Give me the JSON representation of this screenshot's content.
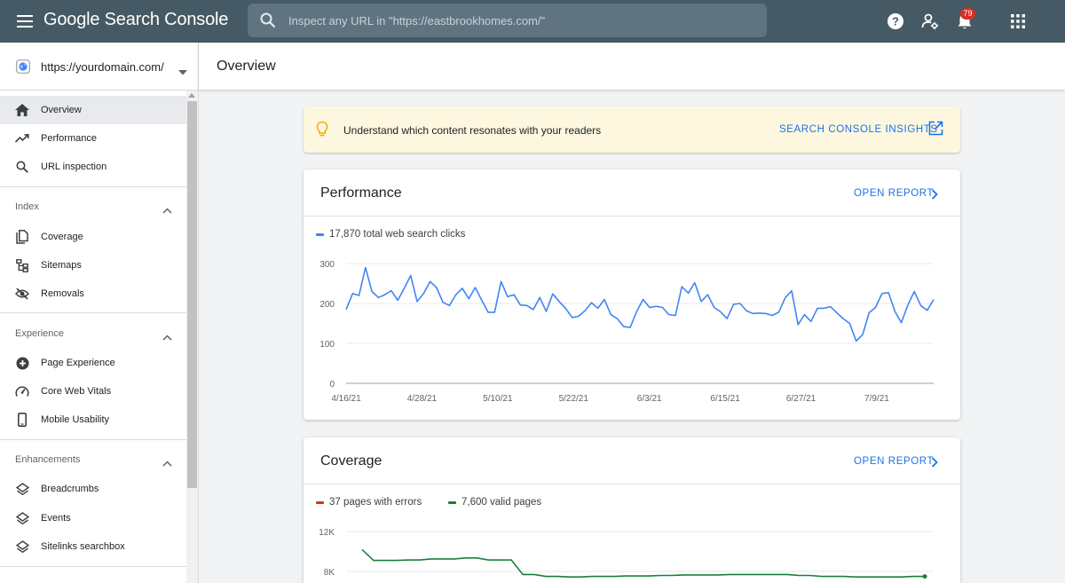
{
  "topbar": {
    "brand": "Google Search Console",
    "search_placeholder": "Inspect any URL in \"https://eastbrookhomes.com/\"",
    "notifications_count": "79"
  },
  "sidebar": {
    "property": "https://yourdomain.com/",
    "main_items": [
      {
        "label": "Overview",
        "icon": "home-icon",
        "active": true
      },
      {
        "label": "Performance",
        "icon": "trending-up-icon"
      },
      {
        "label": "URL inspection",
        "icon": "search-icon"
      }
    ],
    "sections": [
      {
        "title": "Index",
        "items": [
          {
            "label": "Coverage",
            "icon": "file-copy-icon"
          },
          {
            "label": "Sitemaps",
            "icon": "sitemap-icon"
          },
          {
            "label": "Removals",
            "icon": "eye-off-icon"
          }
        ]
      },
      {
        "title": "Experience",
        "items": [
          {
            "label": "Page Experience",
            "icon": "add-circle-icon"
          },
          {
            "label": "Core Web Vitals",
            "icon": "gauge-icon"
          },
          {
            "label": "Mobile Usability",
            "icon": "phone-icon"
          }
        ]
      },
      {
        "title": "Enhancements",
        "items": [
          {
            "label": "Breadcrumbs",
            "icon": "layers-icon"
          },
          {
            "label": "Events",
            "icon": "layers-icon"
          },
          {
            "label": "Sitelinks searchbox",
            "icon": "layers-icon"
          }
        ]
      }
    ]
  },
  "header": {
    "title": "Overview"
  },
  "banner": {
    "text": "Understand which content resonates with your readers",
    "link": "SEARCH CONSOLE INSIGHTS"
  },
  "performance": {
    "title": "Performance",
    "link": "OPEN REPORT",
    "legend": "17,870 total web search clicks"
  },
  "coverage": {
    "title": "Coverage",
    "link": "OPEN REPORT",
    "legend_errors": "37 pages with errors",
    "legend_valid": "7,600 valid pages"
  },
  "colors": {
    "topbar": "#455a64",
    "accent": "#1a73e8",
    "clicks_line": "#4285f4",
    "errors": "#d93025",
    "valid": "#188038",
    "banner_bg": "#fef7e0"
  },
  "chart_data": [
    {
      "type": "line",
      "ylim": [
        0,
        300
      ],
      "yticks": [
        0,
        100,
        200,
        300
      ],
      "xticks": [
        "4/16/21",
        "4/28/21",
        "5/10/21",
        "5/22/21",
        "6/3/21",
        "6/15/21",
        "6/27/21",
        "7/9/21"
      ],
      "x_start": "2021-04-16",
      "x_end": "2021-07-18",
      "grid": true,
      "series": [
        {
          "name": "17,870 total web search clicks",
          "color": "#4285f4",
          "values": [
            185,
            225,
            220,
            290,
            230,
            215,
            222,
            232,
            208,
            238,
            270,
            205,
            225,
            255,
            240,
            203,
            195,
            222,
            238,
            212,
            240,
            208,
            178,
            178,
            255,
            217,
            222,
            196,
            195,
            185,
            215,
            180,
            224,
            205,
            188,
            165,
            168,
            182,
            202,
            188,
            210,
            172,
            162,
            142,
            140,
            180,
            210,
            190,
            193,
            190,
            172,
            170,
            242,
            226,
            252,
            205,
            222,
            190,
            179,
            162,
            198,
            200,
            182,
            175,
            176,
            175,
            170,
            178,
            214,
            232,
            147,
            172,
            155,
            188,
            188,
            192,
            177,
            162,
            150,
            106,
            122,
            177,
            190,
            225,
            227,
            180,
            152,
            196,
            230,
            195,
            183,
            210
          ]
        }
      ]
    },
    {
      "type": "line",
      "ylim": [
        7500,
        12500
      ],
      "yticks": [
        "12K",
        "8K"
      ],
      "grid": true,
      "series": [
        {
          "name": "37 pages with errors",
          "color": "#d93025",
          "values": []
        },
        {
          "name": "7,600 valid pages",
          "color": "#188038",
          "values": [
            10200,
            9100,
            9100,
            9100,
            9150,
            9150,
            9250,
            9250,
            9250,
            9350,
            9350,
            9150,
            9150,
            9150,
            7700,
            7700,
            7500,
            7500,
            7450,
            7450,
            7500,
            7500,
            7500,
            7550,
            7550,
            7550,
            7600,
            7600,
            7650,
            7650,
            7650,
            7650,
            7700,
            7700,
            7700,
            7700,
            7700,
            7700,
            7600,
            7600,
            7500,
            7500,
            7500,
            7450,
            7450,
            7450,
            7450,
            7450,
            7500,
            7500
          ]
        }
      ]
    }
  ]
}
